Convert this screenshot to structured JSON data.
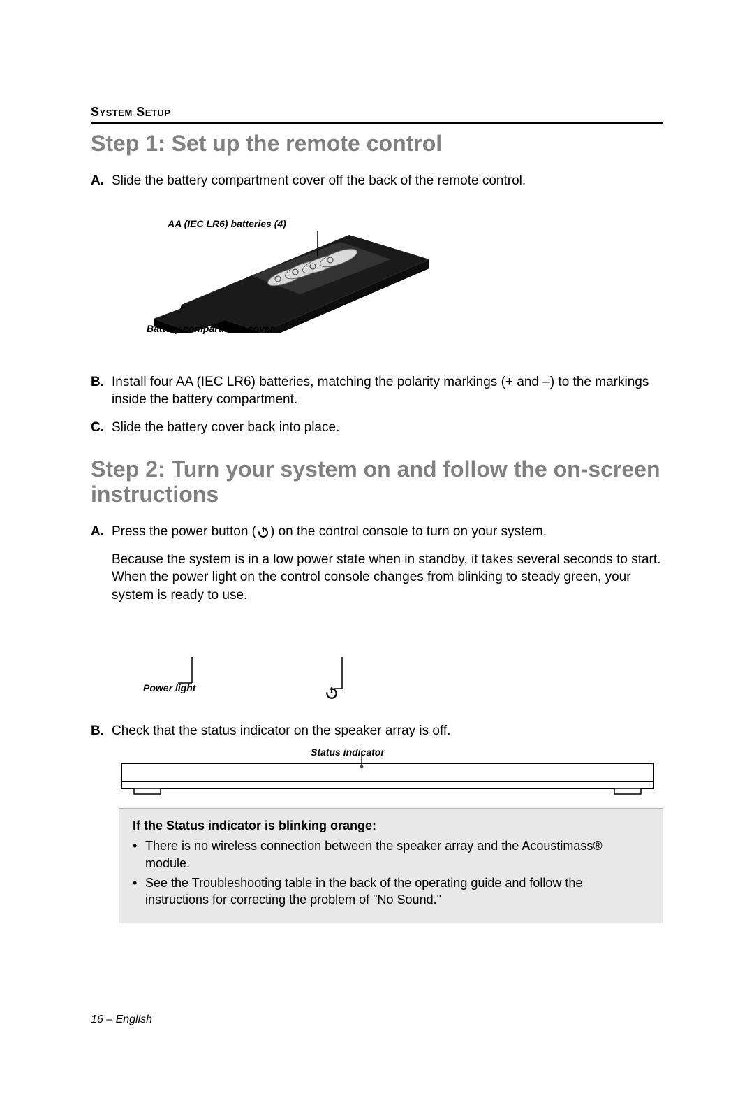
{
  "header": {
    "section_label": "System Setup"
  },
  "step1": {
    "heading": "Step 1:   Set up the remote control",
    "items": {
      "a_letter": "A.",
      "a_text": "Slide the battery compartment cover off the back of the remote control.",
      "b_letter": "B.",
      "b_text": "Install four AA (IEC LR6) batteries, matching the polarity markings (+ and –) to the markings inside the battery compartment.",
      "c_letter": "C.",
      "c_text": "Slide the battery cover back into place."
    },
    "diagram": {
      "label_batteries": "AA (IEC LR6) batteries (4)",
      "label_cover": "Battery compartment cover"
    }
  },
  "step2": {
    "heading": "Step 2:   Turn your system on and follow the on-screen instructions",
    "items": {
      "a_letter": "A.",
      "a_text_before": "Press the power button (",
      "a_text_after": ") on the control console to turn on your system.",
      "a_para2": "Because the system is in a low power state when in standby, it takes several seconds to start. When the power light on the control console changes from blinking to steady green, your system is ready to use.",
      "b_letter": "B.",
      "b_text": "Check that the status indicator on the speaker array is off."
    },
    "diagram_console": {
      "label_power": "Power light"
    },
    "diagram_speaker": {
      "label_status": "Status indicator"
    },
    "note": {
      "heading": "If the Status indicator is blinking orange:",
      "bullets": [
        "There is no wireless connection between the speaker array and the Acoustimass® module.",
        "See the Troubleshooting table in the back of the operating guide and follow the instructions for correcting the problem of \"No Sound.\""
      ]
    }
  },
  "footer": {
    "page_label": "16 – English"
  }
}
